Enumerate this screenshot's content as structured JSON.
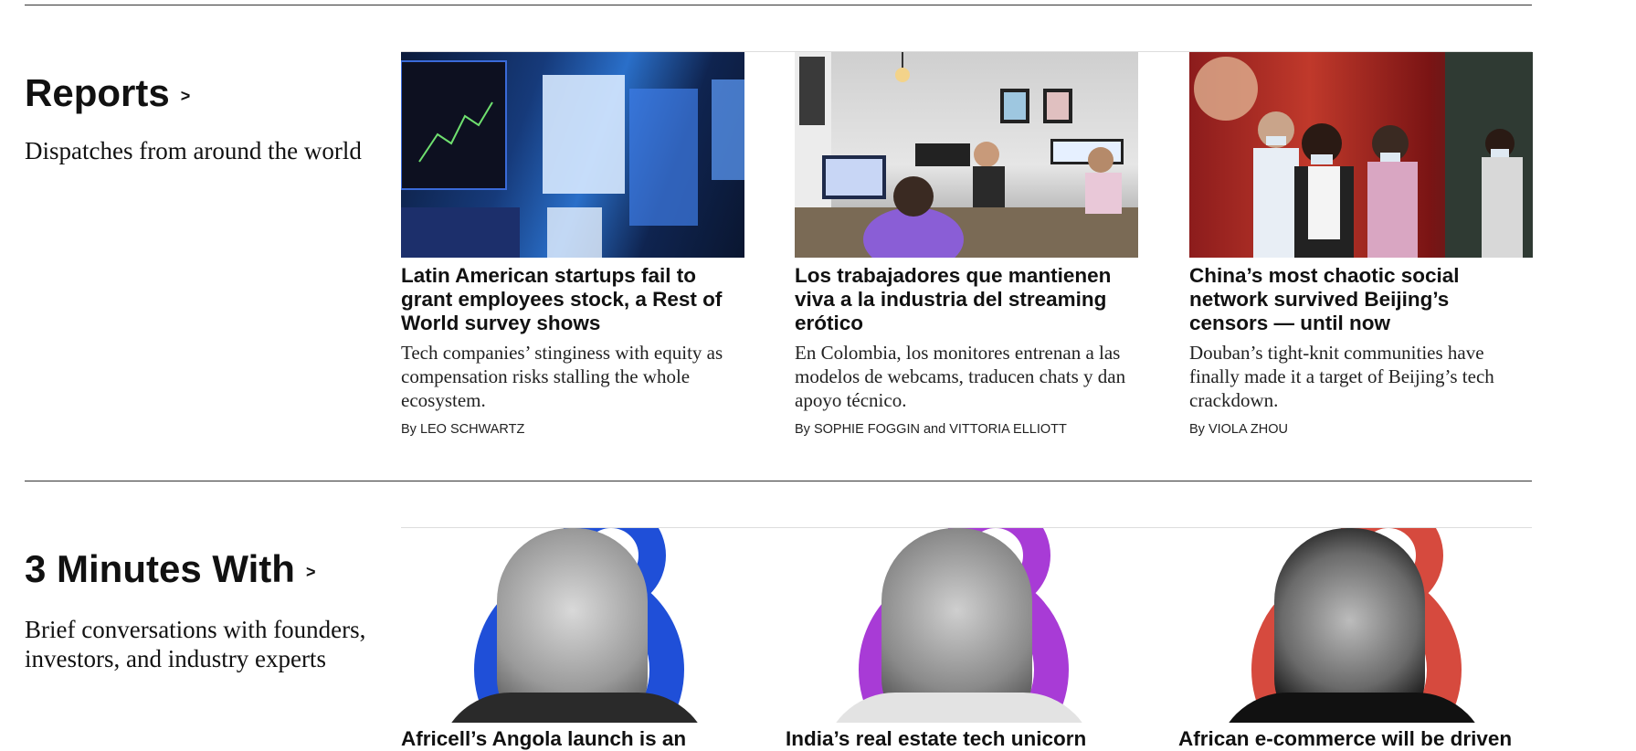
{
  "reports": {
    "title": "Reports",
    "arrow": ">",
    "description": "Dispatches from around the world",
    "articles": [
      {
        "image_icon": "trading-screens-photo",
        "headline": "Latin American startups fail to grant employees stock, a Rest of World survey shows",
        "dek": "Tech companies’ stinginess with equity as compensation risks stalling the whole ecosystem.",
        "byline": "By LEO SCHWARTZ"
      },
      {
        "image_icon": "office-computers-photo",
        "headline": "Los trabajadores que mantienen viva a la industria del streaming erótico",
        "dek": "En Colombia, los monitores entrenan a las modelos de webcams, traducen chats y dan apoyo técnico.",
        "byline": "By SOPHIE FOGGIN and VITTORIA ELLIOTT"
      },
      {
        "image_icon": "masked-people-phones-photo",
        "headline": "China’s most chaotic social network survived Beijing’s censors — until now",
        "dek": "Douban’s tight-knit communities have finally made it a target of Beijing’s tech crackdown.",
        "byline": "By VIOLA ZHOU"
      }
    ]
  },
  "three_minutes": {
    "title": "3 Minutes With",
    "arrow": ">",
    "description": "Brief conversations with founders, investors, and industry experts",
    "articles": [
      {
        "image_icon": "portrait-man-blue-logo",
        "accent": "#1f4fd8",
        "headline": "Africell’s Angola launch is an"
      },
      {
        "image_icon": "portrait-man-purple-logo",
        "accent": "#a83bd6",
        "headline": "India’s real estate tech unicorn"
      },
      {
        "image_icon": "portrait-woman-red-logo",
        "accent": "#d64a3e",
        "headline": "African e-commerce will be driven"
      }
    ]
  }
}
